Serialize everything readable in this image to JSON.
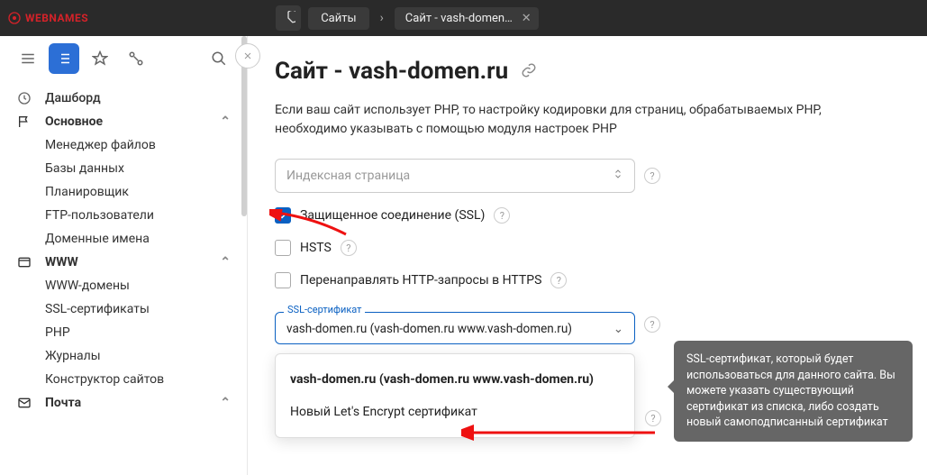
{
  "logo": "WEBNAMES",
  "tabs": {
    "sites": "Сайты",
    "current": "Сайт - vash-domen…"
  },
  "sidebar": {
    "dashboard": "Дашборд",
    "main": {
      "label": "Основное",
      "items": [
        "Менеджер файлов",
        "Базы данных",
        "Планировщик",
        "FTP-пользователи",
        "Доменные имена"
      ]
    },
    "www": {
      "label": "WWW",
      "items": [
        "WWW-домены",
        "SSL-сертификаты",
        "PHP",
        "Журналы",
        "Конструктор сайтов"
      ]
    },
    "mail": "Почта"
  },
  "page": {
    "title": "Сайт - vash-domen.ru",
    "desc": "Если ваш сайт использует PHP, то настройку кодировки для страниц, обрабатываемых PHP, необходимо указывать с помощью модуля настроек PHP",
    "index_placeholder": "Индексная страница",
    "ssl_label": "Защищенное соединение (SSL)",
    "hsts_label": "HSTS",
    "redirect_label": "Перенаправлять HTTP-запросы в HTTPS"
  },
  "select": {
    "legend": "SSL-сертификат",
    "value": "vash-domen.ru (vash-domen.ru www.vash-domen.ru)",
    "options": [
      "vash-domen.ru (vash-domen.ru www.vash-domen.ru)",
      "Новый Let's Encrypt сертификат"
    ]
  },
  "tooltip": "SSL-сертификат, который будет использоваться для данного сайта. Вы можете указать существующий сертификат из списка, либо создать новый самоподписанный сертификат"
}
